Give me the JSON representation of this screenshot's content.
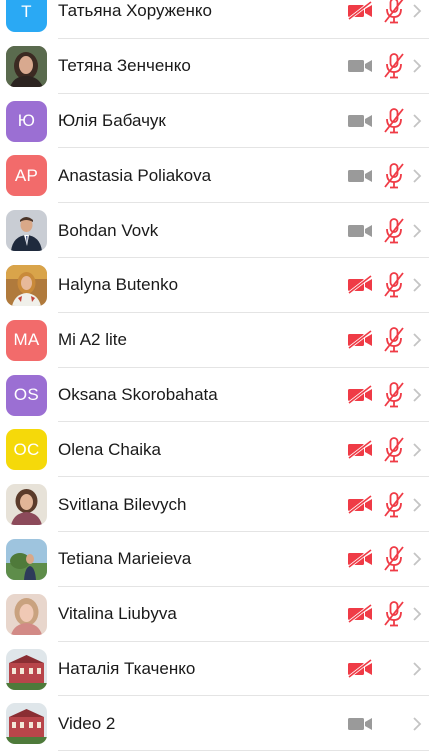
{
  "participants": [
    {
      "name": "Татьяна Хоруженко",
      "avatar_initials": "Т",
      "avatar_color": "#2aa9f4",
      "avatar_type": "initials",
      "camera": "off",
      "mic": "off"
    },
    {
      "name": "Тетяна Зенченко",
      "avatar_type": "photo",
      "camera": "on",
      "mic": "off"
    },
    {
      "name": "Юлія Бабачук",
      "avatar_initials": "Ю",
      "avatar_color": "#9b6fd3",
      "avatar_type": "initials",
      "camera": "on",
      "mic": "off"
    },
    {
      "name": "Anastasia Poliakova",
      "avatar_initials": "AP",
      "avatar_color": "#f26b6b",
      "avatar_type": "initials",
      "camera": "on",
      "mic": "off"
    },
    {
      "name": "Bohdan Vovk",
      "avatar_type": "photo",
      "camera": "on",
      "mic": "off"
    },
    {
      "name": "Halyna Butenko",
      "avatar_type": "photo",
      "camera": "off",
      "mic": "off"
    },
    {
      "name": "Mi A2 lite",
      "avatar_initials": "MA",
      "avatar_color": "#f26b6b",
      "avatar_type": "initials",
      "camera": "off",
      "mic": "off"
    },
    {
      "name": "Oksana Skorobahata",
      "avatar_initials": "OS",
      "avatar_color": "#9b6fd3",
      "avatar_type": "initials",
      "camera": "off",
      "mic": "off"
    },
    {
      "name": "Olena Chaika",
      "avatar_initials": "OC",
      "avatar_color": "#f5d90a",
      "avatar_type": "initials",
      "camera": "off",
      "mic": "off"
    },
    {
      "name": "Svitlana Bilevych",
      "avatar_type": "photo",
      "camera": "off",
      "mic": "off"
    },
    {
      "name": "Tetiana Marieieva",
      "avatar_type": "photo",
      "camera": "off",
      "mic": "off"
    },
    {
      "name": "Vitalina Liubyva",
      "avatar_type": "photo",
      "camera": "off",
      "mic": "off"
    },
    {
      "name": "Наталія Ткаченко",
      "avatar_type": "photo",
      "camera": "off",
      "mic": "none"
    },
    {
      "name": "Video 2",
      "avatar_type": "photo",
      "camera": "on",
      "mic": "none"
    }
  ],
  "icons": {
    "camera": "video-camera-icon",
    "camera_off": "video-camera-off-icon",
    "mic_off": "microphone-off-icon",
    "chevron": "chevron-right-icon"
  },
  "colors": {
    "muted_red": "#ef3b46",
    "camera_gray": "#9a9a9a",
    "chevron_gray": "#c4c4c4"
  }
}
